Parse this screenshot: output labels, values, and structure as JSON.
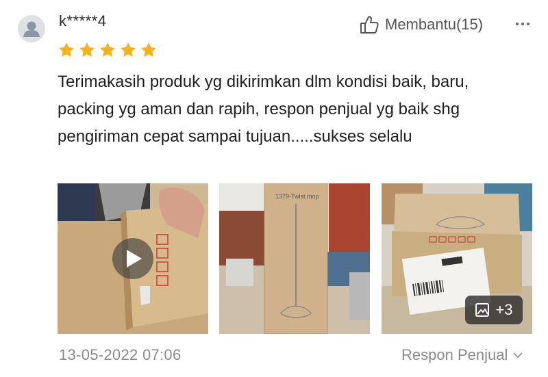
{
  "review": {
    "username": "k*****4",
    "rating": 5,
    "helpful_label": "Membantu(15)",
    "text": "Terimakasih produk yg dikirimkan dlm kondisi baik, baru, packing yg aman dan rapih, respon penjual yg baik shg pengiriman cepat sampai tujuan.....sukses selalu",
    "media_more": "+3",
    "date": "13-05-2022 07:06",
    "seller_reply_label": "Respon Penjual",
    "box_label": "1379-Twist mop"
  },
  "colors": {
    "star": "#f7b21a",
    "text": "#1f1f1f",
    "muted": "#8a8a8a"
  },
  "icons": [
    "user-avatar-icon",
    "thumbs-up-icon",
    "more-dots-icon",
    "star-icon",
    "play-icon",
    "image-icon",
    "chevron-down-icon"
  ]
}
